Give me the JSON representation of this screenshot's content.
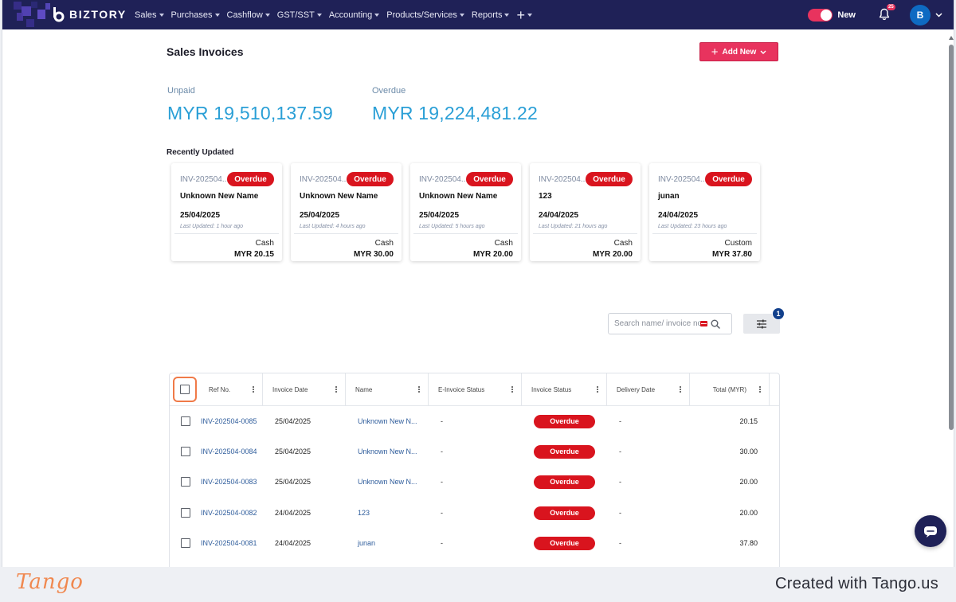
{
  "nav": {
    "brand": "BIZTORY",
    "menu": [
      {
        "label": "Sales"
      },
      {
        "label": "Purchases"
      },
      {
        "label": "Cashflow"
      },
      {
        "label": "GST/SST"
      },
      {
        "label": "Accounting"
      },
      {
        "label": "Products/Services"
      },
      {
        "label": "Reports"
      }
    ],
    "plus_label": "+",
    "toggle_label": "New",
    "notification_count": "25",
    "avatar_initial": "B",
    "accent": "#e8335e",
    "nav_bg": "#1f2157"
  },
  "page": {
    "title": "Sales Invoices",
    "add_button": "Add New"
  },
  "stats": {
    "unpaid_label": "Unpaid",
    "unpaid_value": "MYR 19,510,137.59",
    "overdue_label": "Overdue",
    "overdue_value": "MYR 19,224,481.22"
  },
  "recent": {
    "title": "Recently Updated",
    "cards": [
      {
        "ref": "INV-202504...",
        "status": "Overdue",
        "name": "Unknown New Name",
        "date": "25/04/2025",
        "updated": "Last Updated: 1 hour ago",
        "method": "Cash",
        "amount": "MYR 20.15"
      },
      {
        "ref": "INV-202504...",
        "status": "Overdue",
        "name": "Unknown New Name",
        "date": "25/04/2025",
        "updated": "Last Updated: 4 hours ago",
        "method": "Cash",
        "amount": "MYR 30.00"
      },
      {
        "ref": "INV-202504...",
        "status": "Overdue",
        "name": "Unknown New Name",
        "date": "25/04/2025",
        "updated": "Last Updated: 5 hours ago",
        "method": "Cash",
        "amount": "MYR 20.00"
      },
      {
        "ref": "INV-202504...",
        "status": "Overdue",
        "name": "123",
        "date": "24/04/2025",
        "updated": "Last Updated: 21 hours ago",
        "method": "Cash",
        "amount": "MYR 20.00"
      },
      {
        "ref": "INV-202504...",
        "status": "Overdue",
        "name": "junan",
        "date": "24/04/2025",
        "updated": "Last Updated: 23 hours ago",
        "method": "Custom",
        "amount": "MYR 37.80"
      }
    ]
  },
  "search": {
    "placeholder": "Search name/ invoice no."
  },
  "filter": {
    "badge": "1"
  },
  "table": {
    "columns": [
      "Ref No.",
      "Invoice Date",
      "Name",
      "E-Invoice Status",
      "Invoice Status",
      "Delivery Date",
      "Total (MYR)"
    ],
    "rows": [
      {
        "ref": "INV-202504-0085",
        "date": "25/04/2025",
        "name": "Unknown New N...",
        "einvoice": "-",
        "status": "Overdue",
        "delivery": "-",
        "total": "20.15"
      },
      {
        "ref": "INV-202504-0084",
        "date": "25/04/2025",
        "name": "Unknown New N...",
        "einvoice": "-",
        "status": "Overdue",
        "delivery": "-",
        "total": "30.00"
      },
      {
        "ref": "INV-202504-0083",
        "date": "25/04/2025",
        "name": "Unknown New N...",
        "einvoice": "-",
        "status": "Overdue",
        "delivery": "-",
        "total": "20.00"
      },
      {
        "ref": "INV-202504-0082",
        "date": "24/04/2025",
        "name": "123",
        "einvoice": "-",
        "status": "Overdue",
        "delivery": "-",
        "total": "20.00"
      },
      {
        "ref": "INV-202504-0081",
        "date": "24/04/2025",
        "name": "junan",
        "einvoice": "-",
        "status": "Overdue",
        "delivery": "-",
        "total": "37.80"
      }
    ]
  },
  "footer": {
    "logo": "Tango",
    "credit": "Created with Tango.us"
  }
}
